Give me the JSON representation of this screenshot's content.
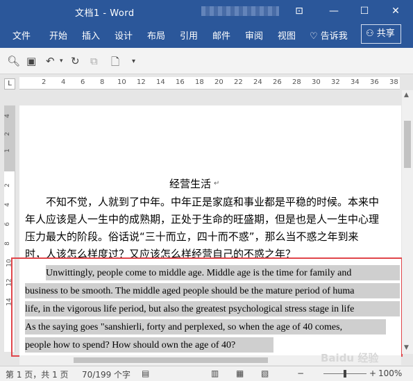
{
  "window": {
    "title": "文档1 - Word",
    "controls": [
      "ribbon-display-icon",
      "minimize-icon",
      "maximize-icon",
      "close-icon"
    ]
  },
  "ribbon": {
    "tabs": [
      "文件",
      "开始",
      "插入",
      "设计",
      "布局",
      "引用",
      "邮件",
      "审阅",
      "视图"
    ],
    "tell_me": "告诉我",
    "share": "共享"
  },
  "ruler": {
    "corner": "L",
    "h_numbers": [
      "2",
      "4",
      "6",
      "8",
      "10",
      "12",
      "14",
      "16",
      "18",
      "20",
      "22",
      "24",
      "26",
      "28",
      "30",
      "32",
      "34",
      "36",
      "38"
    ],
    "v_numbers": [
      "4",
      "2",
      "1",
      "2",
      "4",
      "6",
      "8",
      "10",
      "12",
      "14"
    ]
  },
  "document": {
    "title": "经营生活",
    "cn_lines": [
      "不知不觉，人就到了中年。中年正是家庭和事业都是平稳的时候。本来中",
      "年人应该是人一生中的成熟期，正处于生命的旺盛期，但是也是人一生中心理",
      "压力最大的阶段。俗话说“三十而立，四十而不惑”，那么当不惑之年到来",
      "时，人该怎么样度过？又应该怎么样经营自己的不惑之年？"
    ],
    "en_lines": [
      "Unwittingly, people come to middle age. Middle age is the time for family and",
      "business to be smooth. The middle aged people should be the mature period of huma",
      "life, in the vigorous life period, but also the greatest psychological stress stage in life",
      "As the saying goes \"sanshierli, forty and perplexed, so when the age of 40 comes,",
      "people how to spend? How should own the age of 40?"
    ],
    "para_mark": "↵"
  },
  "statusbar": {
    "page": "第 1 页，共 1 页",
    "words": "70/199 个字",
    "zoom": "100%"
  },
  "watermark": "Baidu 经验"
}
